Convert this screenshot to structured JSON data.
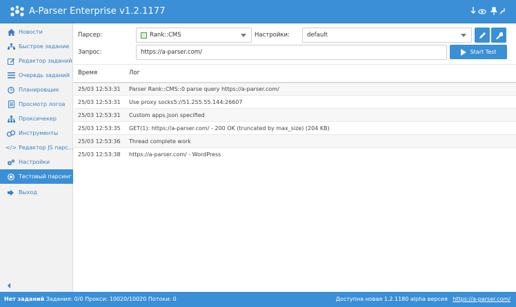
{
  "app": {
    "title": "A-Parser Enterprise v1.2.1177"
  },
  "titlebar_icons": [
    "download-icon",
    "eye-icon",
    "pin-icon",
    "minimize-icon"
  ],
  "sidebar": {
    "items": [
      {
        "label": "Новости",
        "icon": "home-icon"
      },
      {
        "label": "Быстрое задание",
        "icon": "sitemap-icon"
      },
      {
        "label": "Редактор заданий",
        "icon": "edit-icon"
      },
      {
        "label": "Очередь заданий",
        "icon": "list-icon"
      },
      {
        "label": "Планировщик",
        "icon": "clock-icon"
      },
      {
        "label": "Просмотр логов",
        "icon": "file-icon"
      },
      {
        "label": "Проксичекер",
        "icon": "network-icon"
      },
      {
        "label": "Инструменты",
        "icon": "tools-icon"
      },
      {
        "label": "Редактор JS парс...",
        "icon": "code-icon"
      },
      {
        "label": "Настройки",
        "icon": "gears-icon"
      },
      {
        "label": "Тестовый парсинг",
        "icon": "target-icon",
        "active": true
      },
      {
        "label": "Выход",
        "icon": "sign-out-icon"
      }
    ]
  },
  "form": {
    "parser_label": "Парсер:",
    "parser_value": "Rank::CMS",
    "settings_label": "Настройки:",
    "settings_value": "default",
    "query_label": "Запрос:",
    "query_value": "https://a-parser.com/",
    "start_label": "Start Test"
  },
  "log": {
    "columns": [
      "Время",
      "Лог"
    ],
    "rows": [
      {
        "time": "25/03 12:53:31",
        "message": "Parser Rank::CMS::0 parse query https://a-parser.com/"
      },
      {
        "time": "25/03 12:53:31",
        "message": "Use proxy socks5://51.255.55.144:26607"
      },
      {
        "time": "25/03 12:53:31",
        "message": "Custom apps.json specified"
      },
      {
        "time": "25/03 12:53:35",
        "message": "GET(1): https://a-parser.com/ - 200 OK (truncated by max_size) (204 KB)"
      },
      {
        "time": "25/03 12:53:36",
        "message": "Thread complete work"
      },
      {
        "time": "25/03 12:53:38",
        "message": "https://a-parser.com/ - WordPress"
      }
    ]
  },
  "status": {
    "no_tasks": "Нет заданий",
    "details": "Задания: 0/0  Прокси: 10020/10020  Потоки: 0",
    "update_text": "Доступна новая 1.2.1180 alpha версия",
    "update_link": "https://a-parser.com/"
  },
  "colors": {
    "accent": "#3a8fd6",
    "sidebar_bg": "#f2f2f2",
    "link": "#3c7fc4"
  }
}
